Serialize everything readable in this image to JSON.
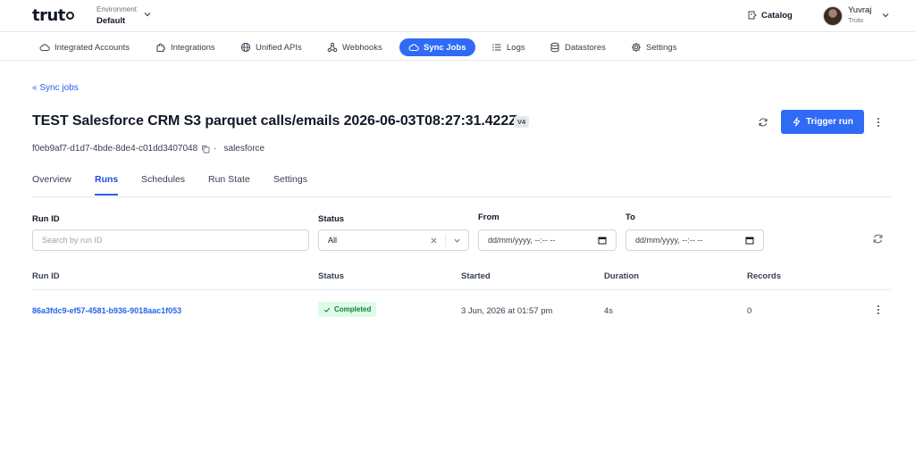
{
  "brand": {
    "logo_text": "trut"
  },
  "environment": {
    "label": "Environment",
    "value": "Default"
  },
  "header": {
    "catalog_label": "Catalog"
  },
  "user": {
    "name": "Yuvraj",
    "org": "Truto"
  },
  "nav": {
    "items": [
      {
        "label": "Integrated Accounts",
        "icon": "cloud-icon"
      },
      {
        "label": "Integrations",
        "icon": "puzzle-icon"
      },
      {
        "label": "Unified APIs",
        "icon": "globe-icon"
      },
      {
        "label": "Webhooks",
        "icon": "webhook-icon"
      },
      {
        "label": "Sync Jobs",
        "icon": "cloud-icon",
        "active": true
      },
      {
        "label": "Logs",
        "icon": "list-icon"
      },
      {
        "label": "Datastores",
        "icon": "database-icon"
      },
      {
        "label": "Settings",
        "icon": "gear-icon"
      }
    ]
  },
  "page": {
    "back_label": "« Sync jobs",
    "title": "TEST Salesforce CRM S3 parquet calls/emails 2026-06-03T08:27:31.422Z",
    "version": "V4",
    "trigger_label": "Trigger run",
    "job_id": "f0eb9af7-d1d7-4bde-8de4-c01dd3407048",
    "separator": "·",
    "integration": "salesforce"
  },
  "tabs": [
    {
      "label": "Overview"
    },
    {
      "label": "Runs",
      "active": true
    },
    {
      "label": "Schedules"
    },
    {
      "label": "Run State"
    },
    {
      "label": "Settings"
    }
  ],
  "filters": {
    "run_id_label": "Run ID",
    "run_id_placeholder": "Search by run ID",
    "status_label": "Status",
    "status_value": "All",
    "from_label": "From",
    "from_placeholder": "dd/mm/yyyy, --:-- --",
    "to_label": "To",
    "to_placeholder": "dd/mm/yyyy, --:-- --"
  },
  "table": {
    "columns": [
      "Run ID",
      "Status",
      "Started",
      "Duration",
      "Records"
    ],
    "rows": [
      {
        "run_id": "86a3fdc9-ef57-4581-b936-9018aac1f053",
        "status": "Completed",
        "started": "3 Jun, 2026 at 01:57 pm",
        "duration": "4s",
        "records": "0"
      }
    ]
  },
  "colors": {
    "accent": "#2f6bf5",
    "link": "#2563eb",
    "success_bg": "#dcfce7",
    "success_text": "#15803d"
  }
}
